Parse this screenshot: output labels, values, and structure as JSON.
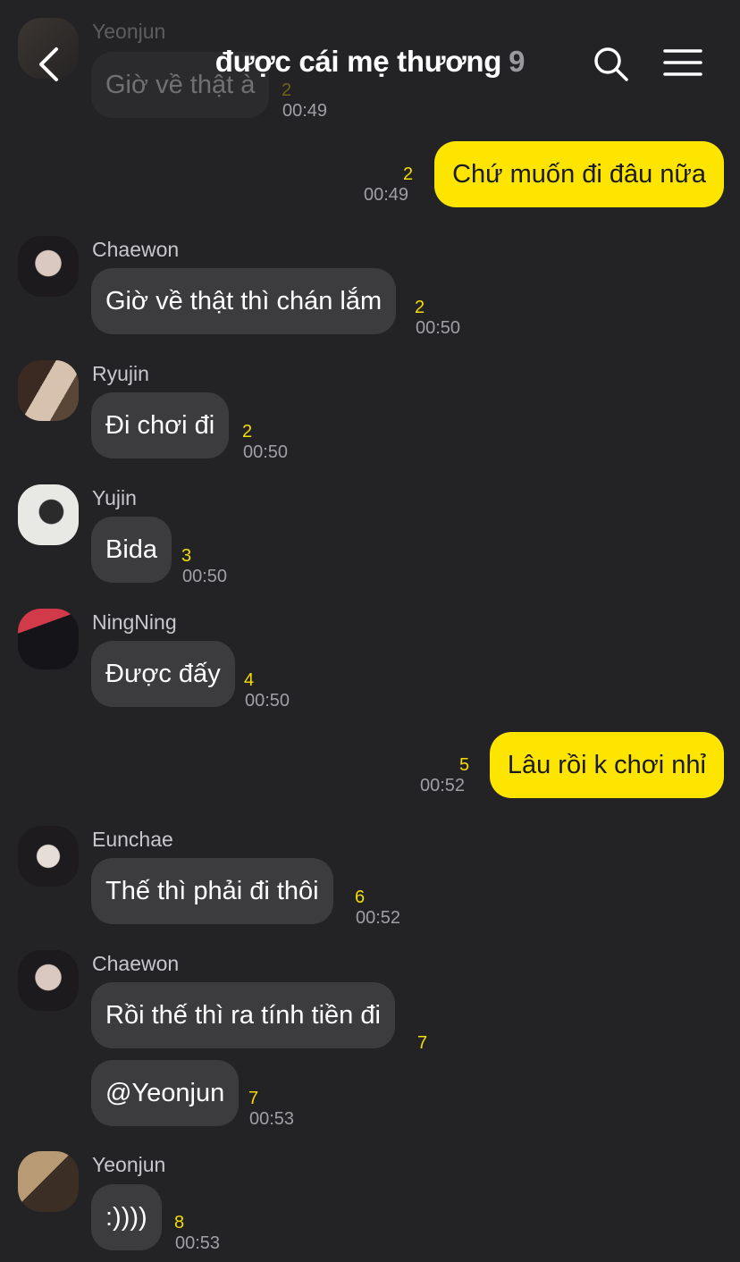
{
  "header": {
    "title": "được cái mẹ thương",
    "member_count": "9"
  },
  "colors": {
    "background": "#232326",
    "my_bubble": "#fee500",
    "other_bubble": "#3c3c3f",
    "unread": "#f5dc00"
  },
  "messages": [
    {
      "sender": "Yeonjun",
      "text": "Giờ về thật à",
      "unread": "2",
      "time": "00:49"
    },
    {
      "text": "Chứ muốn đi đâu nữa",
      "unread": "2",
      "time": "00:49"
    },
    {
      "sender": "Chaewon",
      "text": "Giờ về thật thì chán lắm",
      "unread": "2",
      "time": "00:50"
    },
    {
      "sender": "Ryujin",
      "text": "Đi chơi đi",
      "unread": "2",
      "time": "00:50"
    },
    {
      "sender": "Yujin",
      "text": "Bida",
      "unread": "3",
      "time": "00:50"
    },
    {
      "sender": "NingNing",
      "text": "Được đấy",
      "unread": "4",
      "time": "00:50"
    },
    {
      "text": "Lâu rồi k chơi nhỉ",
      "unread": "5",
      "time": "00:52"
    },
    {
      "sender": "Eunchae",
      "text": "Thế thì phải đi thôi",
      "unread": "6",
      "time": "00:52"
    },
    {
      "sender": "Chaewon",
      "text": "Rồi thế thì ra tính tiền đi",
      "unread": "7"
    },
    {
      "text": "@Yeonjun",
      "unread": "7",
      "time": "00:53"
    },
    {
      "sender": "Yeonjun",
      "text": ":))))",
      "unread": "8",
      "time": "00:53"
    }
  ]
}
